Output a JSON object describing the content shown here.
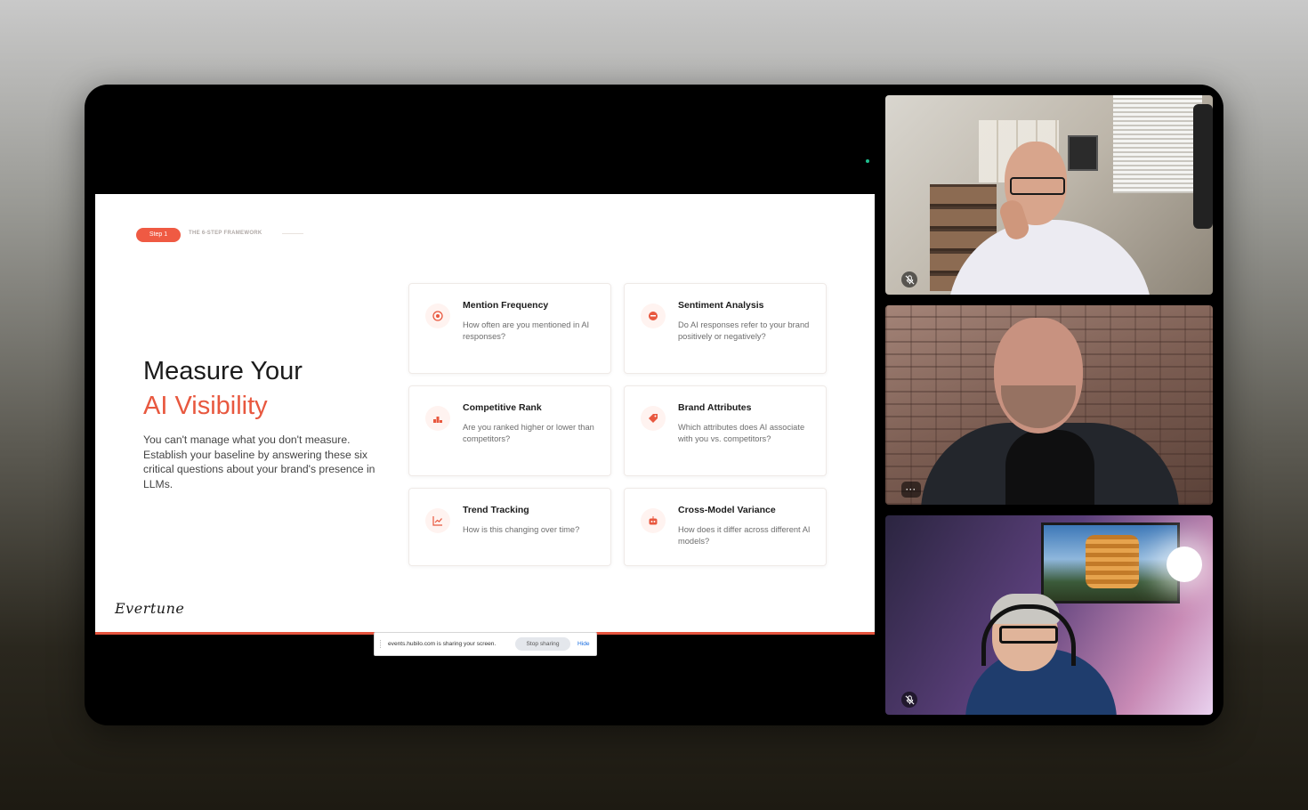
{
  "slide": {
    "step_label": "Step 1",
    "step_caption": "THE 6-STEP FRAMEWORK",
    "headline_line1": "Measure Your",
    "headline_line2": "AI Visibility",
    "lead": "You can't manage what you don't measure. Establish your baseline by answering these six critical questions about your brand's presence in LLMs.",
    "logo_text": "Evertune",
    "accent_color": "#e8583f",
    "cards": [
      {
        "title": "Mention Frequency",
        "desc": "How often are you mentioned in AI responses?",
        "icon": "target-icon"
      },
      {
        "title": "Sentiment Analysis",
        "desc": "Do AI responses refer to your brand positively or negatively?",
        "icon": "sentiment-icon"
      },
      {
        "title": "Competitive Rank",
        "desc": "Are you ranked higher or lower than competitors?",
        "icon": "podium-icon"
      },
      {
        "title": "Brand Attributes",
        "desc": "Which attributes does AI associate with you vs. competitors?",
        "icon": "tag-icon"
      },
      {
        "title": "Trend Tracking",
        "desc": "How is this changing over time?",
        "icon": "trend-chart-icon"
      },
      {
        "title": "Cross-Model Variance",
        "desc": "How does it differ across different AI models?",
        "icon": "robot-icon"
      }
    ]
  },
  "share_bar": {
    "message": "events.hubilo.com is sharing your screen.",
    "stop_label": "Stop sharing",
    "hide_label": "Hide"
  },
  "participants": [
    {
      "status_icon": "mic-muted-icon"
    },
    {
      "status_icon": "more-options-icon",
      "more_label": "···"
    },
    {
      "status_icon": "mic-muted-icon"
    }
  ]
}
